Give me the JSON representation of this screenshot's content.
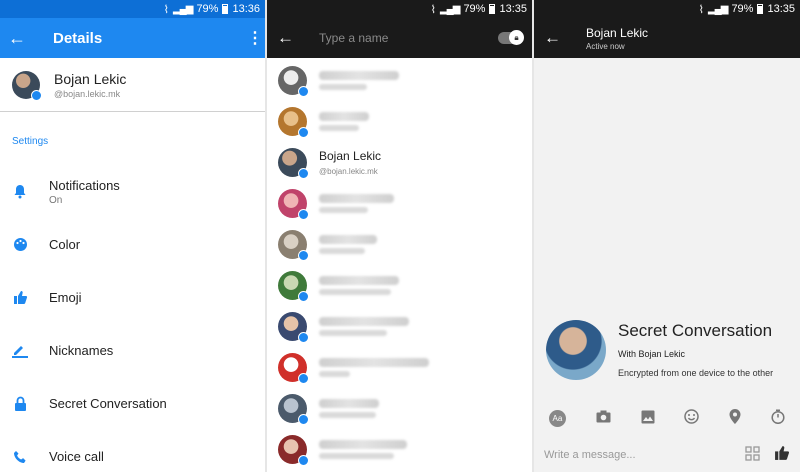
{
  "statusbar": {
    "p1_battery": "79%",
    "p1_time": "13:36",
    "p2_battery": "79%",
    "p2_time": "13:35",
    "p3_battery": "79%",
    "p3_time": "13:35"
  },
  "details": {
    "title": "Details",
    "profile": {
      "name": "Bojan Lekic",
      "handle": "@bojan.lekic.mk"
    },
    "section": "Settings",
    "items": [
      {
        "label": "Notifications",
        "sub": "On",
        "icon": "bell-icon"
      },
      {
        "label": "Color",
        "icon": "palette-icon"
      },
      {
        "label": "Emoji",
        "icon": "thumbs-up-icon"
      },
      {
        "label": "Nicknames",
        "icon": "pencil-icon"
      },
      {
        "label": "Secret Conversation",
        "icon": "lock-icon"
      },
      {
        "label": "Voice call",
        "icon": "phone-icon"
      }
    ],
    "accent": "#1e88f0"
  },
  "search": {
    "placeholder": "Type a name",
    "contacts": [
      {
        "name": "",
        "handle": ""
      },
      {
        "name": "",
        "handle": ""
      },
      {
        "name": "Bojan Lekic",
        "handle": "@bojan.lekic.mk"
      },
      {
        "name": "",
        "handle": ""
      },
      {
        "name": "",
        "handle": ""
      },
      {
        "name": "",
        "handle": ""
      },
      {
        "name": "",
        "handle": ""
      },
      {
        "name": "",
        "handle": ""
      },
      {
        "name": "",
        "handle": ""
      },
      {
        "name": "",
        "handle": ""
      }
    ]
  },
  "chat": {
    "name": "Bojan Lekic",
    "presence": "Active now",
    "secret_title": "Secret Conversation",
    "secret_with": "With Bojan Lekic",
    "secret_desc": "Encrypted from one device to the other",
    "compose_placeholder": "Write a message...",
    "aa_label": "Aa"
  }
}
